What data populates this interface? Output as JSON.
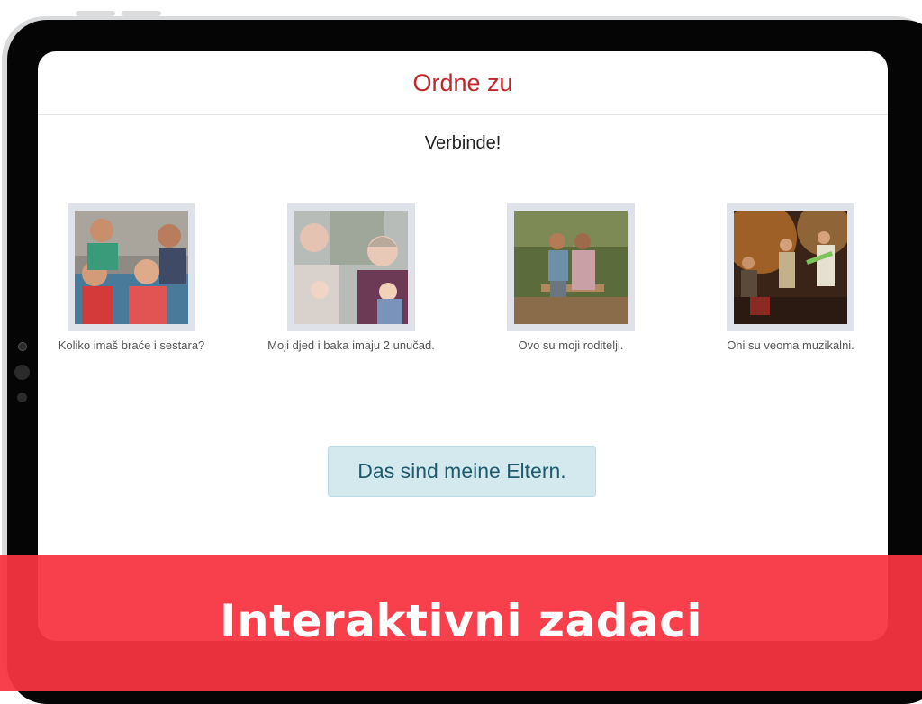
{
  "screen": {
    "title": "Ordne zu",
    "instruction": "Verbinde!"
  },
  "cards": [
    {
      "caption": "Koliko imaš braće i sestara?",
      "photo_icon": "children-photo"
    },
    {
      "caption": "Moji djed i baka imaju 2 unučad.",
      "photo_icon": "grandparents-photo"
    },
    {
      "caption": "Ovo su moji roditelji.",
      "photo_icon": "couple-photo"
    },
    {
      "caption": "Oni su veoma muzikalni.",
      "photo_icon": "band-photo"
    }
  ],
  "answer_chip": {
    "label": "Das sind meine Eltern."
  },
  "banner": {
    "text": "Interaktivni zadaci"
  },
  "colors": {
    "title": "#c0272d",
    "banner": "#f83442",
    "chip_bg": "#d3e9ee",
    "chip_text": "#1f5b6d"
  }
}
